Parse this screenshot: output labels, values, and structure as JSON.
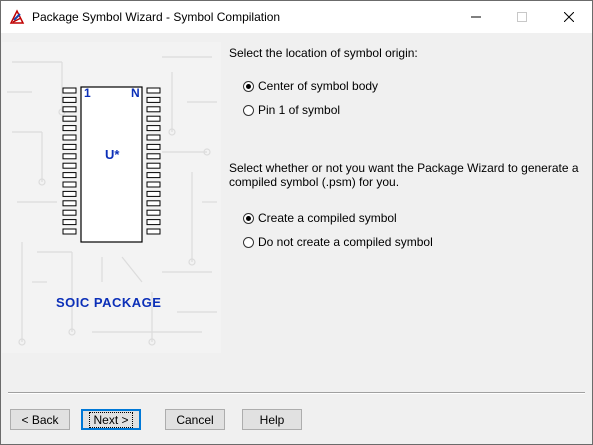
{
  "window": {
    "title": "Package Symbol Wizard - Symbol Compilation",
    "controls": {
      "minimize": "minimize-icon",
      "maximize": "maximize-icon",
      "close": "close-icon"
    }
  },
  "illustration": {
    "pin_first": "1",
    "pin_last": "N",
    "ref_designator": "U*",
    "package_name": "SOIC PACKAGE",
    "accent_color": "#0b2fb8"
  },
  "origin": {
    "prompt": "Select the location of symbol origin:",
    "options": [
      {
        "label": "Center of symbol body",
        "checked": true
      },
      {
        "label": "Pin 1 of symbol",
        "checked": false
      }
    ]
  },
  "compile": {
    "prompt_line1": "Select whether or not you want the Package Wizard to generate a",
    "prompt_line2": "compiled symbol (.psm) for you.",
    "options": [
      {
        "label": "Create a compiled symbol",
        "checked": true
      },
      {
        "label": "Do not create a compiled symbol",
        "checked": false
      }
    ]
  },
  "buttons": {
    "back": "< Back",
    "next": "Next >",
    "cancel": "Cancel",
    "help": "Help"
  }
}
